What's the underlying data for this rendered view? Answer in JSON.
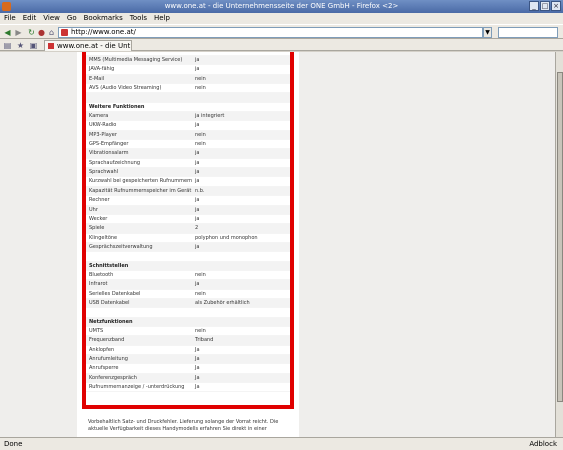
{
  "window": {
    "title": "www.one.at - die Unternehmensseite der ONE GmbH - Firefox <2>"
  },
  "menu": [
    "File",
    "Edit",
    "View",
    "Go",
    "Bookmarks",
    "Tools",
    "Help"
  ],
  "url": "http://www.one.at/",
  "tab": {
    "label": "www.one.at - die Unt..."
  },
  "rows": [
    {
      "label": "",
      "value": "",
      "type": "cut"
    },
    {
      "label": "MMS (Multimedia Messaging Service)",
      "value": "ja"
    },
    {
      "label": "JAVA-fähig",
      "value": "ja"
    },
    {
      "label": "E-Mail",
      "value": "nein"
    },
    {
      "label": "AVS (Audio Video Streaming)",
      "value": "nein"
    },
    {
      "label": "",
      "value": "",
      "type": "blank"
    },
    {
      "label": "Weitere Funktionen",
      "value": "",
      "type": "heading"
    },
    {
      "label": "Kamera",
      "value": "ja integriert"
    },
    {
      "label": "UKW-Radio",
      "value": "ja"
    },
    {
      "label": "MP3-Player",
      "value": "nein"
    },
    {
      "label": "GPS-Empfänger",
      "value": "nein"
    },
    {
      "label": "Vibrationsalarm",
      "value": "ja"
    },
    {
      "label": "Sprachaufzeichnung",
      "value": "ja"
    },
    {
      "label": "Sprachwahl",
      "value": "ja"
    },
    {
      "label": "Kurzwahl bei gespeicherten Rufnummern",
      "value": "ja"
    },
    {
      "label": "Kapazität Rufnummernspeicher im Gerät",
      "value": "n.b."
    },
    {
      "label": "Rechner",
      "value": "ja"
    },
    {
      "label": "Uhr",
      "value": "ja"
    },
    {
      "label": "Wecker",
      "value": "ja"
    },
    {
      "label": "Spiele",
      "value": "2"
    },
    {
      "label": "Klingeltöne",
      "value": "polyphon und monophon"
    },
    {
      "label": "Gesprächszeitverwaltung",
      "value": "ja"
    },
    {
      "label": "",
      "value": "",
      "type": "blank"
    },
    {
      "label": "Schnittstellen",
      "value": "",
      "type": "heading"
    },
    {
      "label": "Bluetooth",
      "value": "nein"
    },
    {
      "label": "Infrarot",
      "value": "ja"
    },
    {
      "label": "Serielles Datenkabel",
      "value": "nein"
    },
    {
      "label": "USB Datenkabel",
      "value": "als Zubehör erhältlich"
    },
    {
      "label": "",
      "value": "",
      "type": "blank"
    },
    {
      "label": "Netzfunktionen",
      "value": "",
      "type": "heading"
    },
    {
      "label": "UMTS",
      "value": "nein"
    },
    {
      "label": "Frequenzband",
      "value": "Triband"
    },
    {
      "label": "Anklopfen",
      "value": "Ja"
    },
    {
      "label": "Anrufumleitung",
      "value": "Ja"
    },
    {
      "label": "Anrufsperre",
      "value": "Ja"
    },
    {
      "label": "Konferenzgespräch",
      "value": "Ja"
    },
    {
      "label": "Rufnummernanzeige / -unterdrückung",
      "value": "Ja"
    }
  ],
  "footnote": "Vorbehaltlich Satz- und Druckfehler. Lieferung solange der Vorrat reicht. Die aktuelle Verfügbarkeit dieses Handymodells erfahren Sie direkt in einer",
  "status": {
    "text": "Done",
    "adblock": "Adblock"
  }
}
